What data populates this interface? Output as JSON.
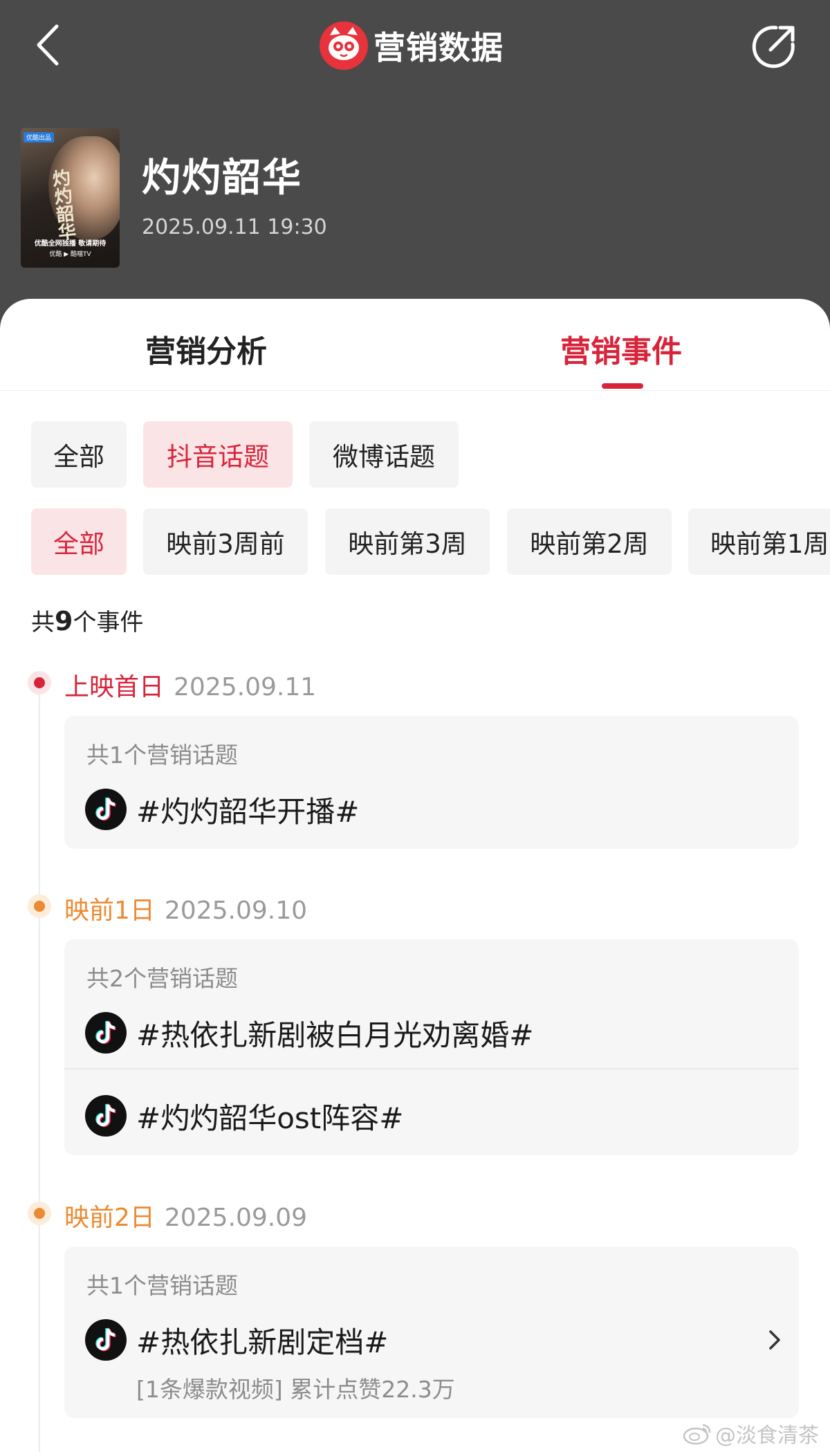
{
  "header": {
    "title": "营销数据",
    "back_icon": "chevron-left-icon",
    "share_icon": "share-icon",
    "logo_icon": "cat-logo-icon"
  },
  "movie": {
    "title": "灼灼韶华",
    "datetime": "2025.09.11 19:30",
    "poster": {
      "tag": "优酷出品",
      "calligraphy": "灼灼韶华",
      "line1": "优酷全网独播 敬请期待",
      "line2": "优酷 ▶ 酷喵TV"
    }
  },
  "tabs": [
    {
      "label": "营销分析",
      "active": false
    },
    {
      "label": "营销事件",
      "active": true
    }
  ],
  "platform_filters": [
    {
      "label": "全部",
      "active": false
    },
    {
      "label": "抖音话题",
      "active": true
    },
    {
      "label": "微博话题",
      "active": false
    }
  ],
  "period_filters": [
    {
      "label": "全部",
      "active": true
    },
    {
      "label": "映前3周前",
      "active": false
    },
    {
      "label": "映前第3周",
      "active": false
    },
    {
      "label": "映前第2周",
      "active": false
    },
    {
      "label": "映前第1周",
      "active": false
    }
  ],
  "event_count": {
    "prefix": "共",
    "number": "9",
    "suffix": "个事件"
  },
  "timeline": [
    {
      "label": "上映首日",
      "date": "2025.09.11",
      "color": "#d8243a",
      "count_text": "共1个营销话题",
      "topics": [
        {
          "text": "#灼灼韶华开播#",
          "icon": "tiktok-icon"
        }
      ]
    },
    {
      "label": "映前1日",
      "date": "2025.09.10",
      "color": "#ec8a32",
      "count_text": "共2个营销话题",
      "topics": [
        {
          "text": "#热依扎新剧被白月光劝离婚#",
          "icon": "tiktok-icon"
        },
        {
          "text": "#灼灼韶华ost阵容#",
          "icon": "tiktok-icon"
        }
      ]
    },
    {
      "label": "映前2日",
      "date": "2025.09.09",
      "color": "#ec8a32",
      "count_text": "共1个营销话题",
      "topics": [
        {
          "text": "#热依扎新剧定档#",
          "icon": "tiktok-icon",
          "note": "[1条爆款视频] 累计点赞22.3万"
        }
      ]
    }
  ],
  "watermark": {
    "text": "@淡食清茶",
    "icon": "weibo-icon"
  }
}
